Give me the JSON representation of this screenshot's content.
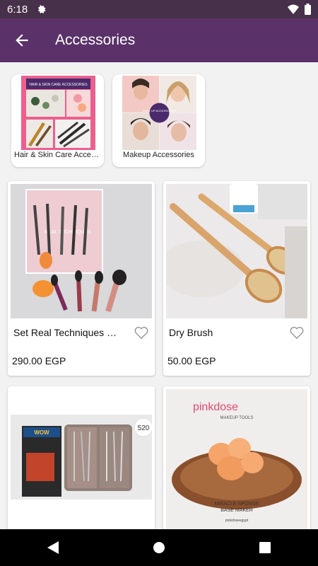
{
  "status_bar": {
    "time": "6:18"
  },
  "app_bar": {
    "title": "Accessories"
  },
  "categories": [
    {
      "label": "Hair & Skin Care Accessories",
      "banner_text": "HAIR & SKIN CARE ACCESSORIES"
    },
    {
      "label": "Makeup Accessories",
      "badge_text": "MAKE UP ACCESSORIES"
    }
  ],
  "products": [
    {
      "name": "Set Real Techniques Brushes",
      "price": "290.00 EGP",
      "box_text": "REAL TECHNIQUES"
    },
    {
      "name": "Dry Brush",
      "price": "50.00 EGP"
    },
    {
      "name": "",
      "price": "",
      "badge": "520",
      "box_text": "WOW"
    },
    {
      "name": "",
      "price": "",
      "brand": "pinkdose",
      "tagline": "MAKEUP TOOLS",
      "caption1": "MIRACLE SPONGE",
      "caption2": "BASE MAKER",
      "social": "pinkdoseegypt"
    }
  ],
  "colors": {
    "status_bar": "#473049",
    "app_bar": "#5a3168",
    "background": "#f2f2f2"
  }
}
